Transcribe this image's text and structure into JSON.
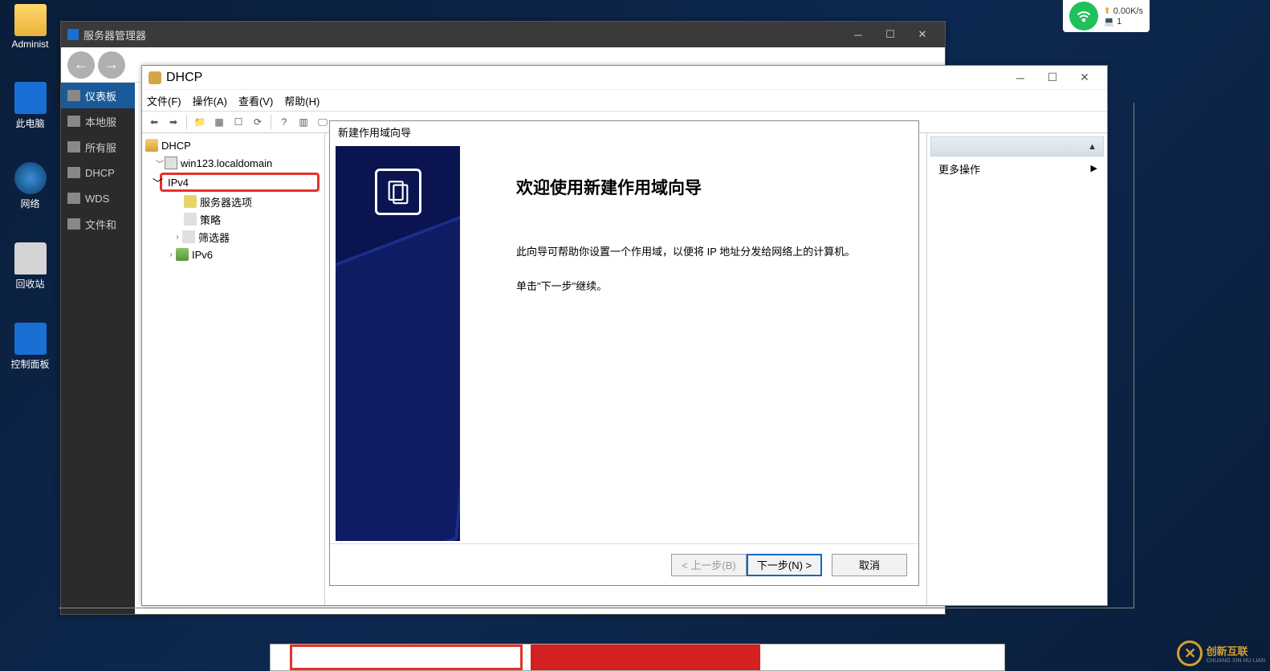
{
  "desktop": {
    "icons": [
      "Administ",
      "此电脑",
      "网络",
      "回收站",
      "控制面板"
    ]
  },
  "net_widget": {
    "speed": "0.00K/s",
    "conn": "1"
  },
  "server_manager": {
    "title": "服务器管理器",
    "sidebar": [
      "仪表板",
      "本地服",
      "所有服",
      "DHCP",
      "WDS",
      "文件和"
    ]
  },
  "dhcp": {
    "title": "DHCP",
    "menu": [
      "文件(F)",
      "操作(A)",
      "查看(V)",
      "帮助(H)"
    ],
    "tree": {
      "root": "DHCP",
      "server": "win123.localdomain",
      "ipv4": "IPv4",
      "ipv4_children": [
        "服务器选项",
        "策略",
        "筛选器"
      ],
      "ipv6": "IPv6"
    },
    "actions": {
      "header_partial": "更多操作"
    }
  },
  "wizard": {
    "title": "新建作用域向导",
    "heading": "欢迎使用新建作用域向导",
    "body1": "此向导可帮助你设置一个作用域，以便将 IP 地址分发给网络上的计算机。",
    "body2": "单击\"下一步\"继续。",
    "back": "< 上一步(B)",
    "next": "下一步(N) >",
    "cancel": "取消"
  },
  "corner": {
    "brand": "创新互联",
    "sub": "CHUANG XIN HU LIAN"
  }
}
